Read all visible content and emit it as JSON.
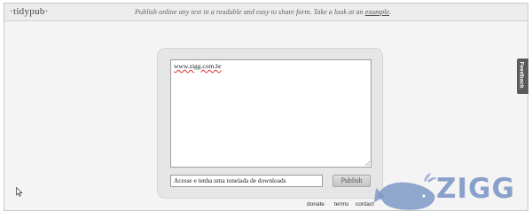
{
  "header": {
    "logo": "·tidypub·",
    "tagline": "Publish online any text in a readable and easy to share form. Take a look at an ",
    "tagline_link": "example",
    "tagline_end": "."
  },
  "editor": {
    "content": "www.zigg.com.br"
  },
  "form": {
    "title_value": "Acesse e tenha uma tonelada de downloads",
    "publish_label": "Publish"
  },
  "feedback": {
    "label": "Feedback"
  },
  "footer": {
    "links": [
      "donate",
      "terms",
      "contact"
    ]
  },
  "watermark": {
    "text": "ZIGG"
  },
  "colors": {
    "topbar": "#ececec",
    "page_bg": "#f4f4f4",
    "panel_bg": "#e6e6e6",
    "feedback_bg": "#5b5b5b",
    "watermark": "#7d98c6"
  }
}
